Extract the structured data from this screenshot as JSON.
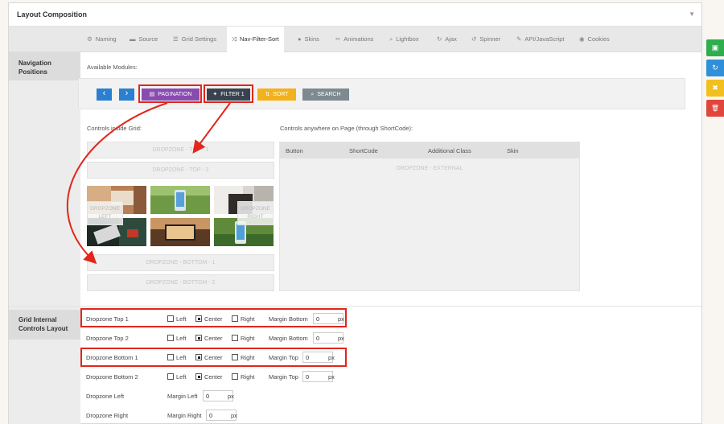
{
  "panel": {
    "title": "Layout Composition"
  },
  "tabs": [
    {
      "label": "Naming",
      "icon": "gear-icon",
      "glyph": "⚙"
    },
    {
      "label": "Source",
      "icon": "folder-icon",
      "glyph": "▬"
    },
    {
      "label": "Grid Settings",
      "icon": "list-icon",
      "glyph": "☰"
    },
    {
      "label": "Nav-Filter-Sort",
      "icon": "shuffle-icon",
      "glyph": "⤨"
    },
    {
      "label": "Skins",
      "icon": "droplet-icon",
      "glyph": "●"
    },
    {
      "label": "Animations",
      "icon": "wrench-icon",
      "glyph": "✂"
    },
    {
      "label": "Lightbox",
      "icon": "search-icon",
      "glyph": "⌕"
    },
    {
      "label": "Ajax",
      "icon": "refresh-icon",
      "glyph": "↻"
    },
    {
      "label": "Spinner",
      "icon": "history-icon",
      "glyph": "↺"
    },
    {
      "label": "API/JavaScript",
      "icon": "magic-icon",
      "glyph": "✎"
    },
    {
      "label": "Cookies",
      "icon": "eye-icon",
      "glyph": "◉"
    }
  ],
  "active_tab": "Nav-Filter-Sort",
  "sections": {
    "nav_positions": "Navigation Positions",
    "grid_internal": "Grid Internal Controls Layout"
  },
  "available_modules": {
    "label": "Available Modules:",
    "prev_glyph": "‹",
    "next_glyph": "›",
    "pagination": "PAGINATION",
    "filter": "FILTER 1",
    "sort": "SORT",
    "search": "SEARCH"
  },
  "grid": {
    "label": "Controls inside Grid:",
    "top1": "DROPZONE - TOP - 1",
    "top2": "DROPZONE - TOP - 2",
    "left": "DROPZONE LEFT",
    "right": "DROPZONE RIGHT",
    "bottom1": "DROPZONE - BOTTOM - 1",
    "bottom2": "DROPZONE - BOTTOM - 2"
  },
  "external": {
    "label": "Controls anywhere on Page (through ShortCode):",
    "columns": [
      "Button",
      "ShortCode",
      "Additional Class",
      "Skin"
    ],
    "dropzone": "DROPZONE - EXTERNAL"
  },
  "layout_rows": [
    {
      "label": "Dropzone Top 1",
      "left": "Left",
      "center": "Center",
      "right": "Right",
      "checked": "center",
      "margin_label": "Margin Bottom",
      "margin_value": "0",
      "unit": "px"
    },
    {
      "label": "Dropzone Top 2",
      "left": "Left",
      "center": "Center",
      "right": "Right",
      "checked": "center",
      "margin_label": "Margin Bottom",
      "margin_value": "0",
      "unit": "px"
    },
    {
      "label": "Dropzone Bottom 1",
      "left": "Left",
      "center": "Center",
      "right": "Right",
      "checked": "center",
      "margin_label": "Margin Top",
      "margin_value": "0",
      "unit": "px"
    },
    {
      "label": "Dropzone Bottom 2",
      "left": "Left",
      "center": "Center",
      "right": "Right",
      "checked": "center",
      "margin_label": "Margin Top",
      "margin_value": "0",
      "unit": "px"
    }
  ],
  "side_rows": [
    {
      "label": "Dropzone Left",
      "margin_label": "Margin Left",
      "margin_value": "0",
      "unit": "px"
    },
    {
      "label": "Dropzone Right",
      "margin_label": "Margin Right",
      "margin_value": "0",
      "unit": "px"
    }
  ],
  "side_buttons": [
    {
      "icon": "save-icon",
      "glyph": "▣",
      "color": "#2fae4e"
    },
    {
      "icon": "refresh-icon",
      "glyph": "↻",
      "color": "#2f8fd8"
    },
    {
      "icon": "close-icon",
      "glyph": "✖",
      "color": "#f2c01e"
    },
    {
      "icon": "trash-icon",
      "glyph": "🗑",
      "color": "#e0463c"
    }
  ],
  "colors": {
    "pagination": "#8a4bb0",
    "filter": "#3a4250",
    "sort": "#f2b21e",
    "search": "#7d8a8f",
    "nav_arrow": "#2b7fd0",
    "highlight": "#e1261c"
  }
}
